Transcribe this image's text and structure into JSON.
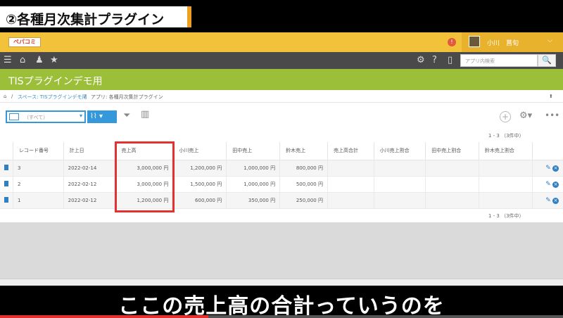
{
  "video": {
    "title": "②各種月次集計プラグイン",
    "subtitle": "ここの売上高の合計っていうのを",
    "progress": 0.37
  },
  "header": {
    "logo_text": "ペパコミ",
    "notif": "!",
    "user_name": "小川　菖旬",
    "chevron": "⌵"
  },
  "nav": {
    "search_placeholder": "アプリ内検索",
    "search_icon": "🔍"
  },
  "space": {
    "title": "TISプラグインデモ用"
  },
  "breadcrumb": {
    "home_icon": "⌂",
    "space": "スペース: TISプラグインデモ用",
    "sep": "/",
    "app": "アプリ: 各種月次集計プラグイン",
    "pin_icon": "⬆"
  },
  "toolbar": {
    "view_label": "（すべて）",
    "graph_icon": "⌇⌇",
    "add_icon": "+",
    "more_icon": "•••"
  },
  "paging": {
    "top": "1 - 3 （3件中）",
    "bottom": "1 - 3 （3件中）"
  },
  "table": {
    "columns": [
      "",
      "レコード番号",
      "計上日",
      "売上高",
      "小川売上",
      "田中売上",
      "鈴木売上",
      "売上高合計",
      "小川売上割合",
      "田中売上割合",
      "鈴木売上割合",
      ""
    ],
    "rows": [
      {
        "no": "3",
        "date": "2022-02-14",
        "sales": "3,000,000 円",
        "ogawa": "1,200,000 円",
        "tanaka": "1,000,000 円",
        "suzuki": "800,000 円"
      },
      {
        "no": "2",
        "date": "2022-02-12",
        "sales": "3,000,000 円",
        "ogawa": "1,500,000 円",
        "tanaka": "1,000,000 円",
        "suzuki": "500,000 円"
      },
      {
        "no": "1",
        "date": "2022-02-12",
        "sales": "1,200,000 円",
        "ogawa": "600,000 円",
        "tanaka": "350,000 円",
        "suzuki": "250,000 円"
      }
    ],
    "edit_icon": "✎",
    "delete_icon": "×"
  },
  "colors": {
    "header_bg": "#f2c23a",
    "nav_bg": "#4a4a4a",
    "space_bg": "#9cbf3a",
    "accent": "#3498db",
    "highlight": "#e53030"
  }
}
